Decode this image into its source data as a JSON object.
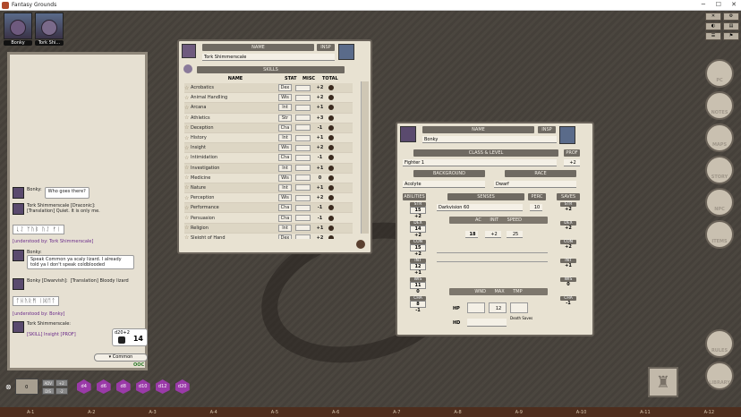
{
  "window": {
    "title": "Fantasy Grounds"
  },
  "party": [
    {
      "name": "Bonky"
    },
    {
      "name": "Tork Shi..."
    }
  ],
  "chat": {
    "messages": [
      {
        "speaker": "Bonky:",
        "text": "Who goes there?"
      },
      {
        "speaker": "Tork Shimmerscale [Draconic]:",
        "text": "[Translation] Quiet. It is only me."
      },
      {
        "runes": "ᚳᛇ ᛉᚢᛒ ᚢᛇ ᚠᛁ"
      },
      {
        "system": "[understood by: Tork Shimmerscale]"
      },
      {
        "speaker": "Bonky:",
        "text": "Speak Common ya scaly lizard. I already told ya I don't speak coldblooded"
      },
      {
        "speaker": "Bonky [Dwarvish]:",
        "text": "[Translation] Bloody lizard"
      },
      {
        "runes": "ᛏᚺᚢᚱᛗ ᛁᛞᛖᛏ"
      },
      {
        "system": "[understood by: Bonky]"
      },
      {
        "speaker": "Tork Shimmerscale:",
        "text": "[SKILL] Insight [PROF]"
      }
    ],
    "dice_expr": "d20+2",
    "dice_total": "14",
    "language": "Common",
    "occ": "OOC"
  },
  "sheet1": {
    "name_label": "NAME",
    "insp_label": "INSP",
    "name": "Tork Shimmerscale",
    "skills_label": "SKILLS",
    "columns": [
      "NAME",
      "STAT",
      "MISC",
      "TOTAL"
    ],
    "skills": [
      {
        "name": "Acrobatics",
        "stat": "Dex",
        "total": "+2"
      },
      {
        "name": "Animal Handling",
        "stat": "Wis",
        "total": "+2"
      },
      {
        "name": "Arcana",
        "stat": "Int",
        "total": "+1"
      },
      {
        "name": "Athletics",
        "stat": "Str",
        "total": "+3"
      },
      {
        "name": "Deception",
        "stat": "Cha",
        "total": "-1"
      },
      {
        "name": "History",
        "stat": "Int",
        "total": "+1"
      },
      {
        "name": "Insight",
        "stat": "Wis",
        "total": "+2"
      },
      {
        "name": "Intimidation",
        "stat": "Cha",
        "total": "-1"
      },
      {
        "name": "Investigation",
        "stat": "Int",
        "total": "+1"
      },
      {
        "name": "Medicine",
        "stat": "Wis",
        "total": "0"
      },
      {
        "name": "Nature",
        "stat": "Int",
        "total": "+1"
      },
      {
        "name": "Perception",
        "stat": "Wis",
        "total": "+2"
      },
      {
        "name": "Performance",
        "stat": "Cha",
        "total": "-1"
      },
      {
        "name": "Persuasion",
        "stat": "Cha",
        "total": "-1"
      },
      {
        "name": "Religion",
        "stat": "Int",
        "total": "+1"
      },
      {
        "name": "Sleight of Hand",
        "stat": "Dex",
        "total": "+2"
      }
    ]
  },
  "sheet2": {
    "name_label": "NAME",
    "insp_label": "INSP",
    "name": "Bonky",
    "class_label": "CLASS & LEVEL",
    "prof_label": "PROF",
    "class": "Fighter 1",
    "prof": "+2",
    "background_label": "BACKGROUND",
    "race_label": "RACE",
    "background": "Acolyte",
    "race": "Dwarf",
    "abilities_label": "ABILITIES",
    "senses_label": "SENSES",
    "perc_label": "PERC",
    "saves_label": "SAVES",
    "senses": "Darkvision 60",
    "perc": "10",
    "ac_label": "AC",
    "init_label": "INIT",
    "speed_label": "SPEED",
    "ac": "18",
    "init": "+2",
    "speed": "25",
    "wounds_label": "WND",
    "max_label": "MAX",
    "temp_label": "TMP",
    "hp_label": "HP",
    "hd_label": "HD",
    "max_hp": "12",
    "death_saves_label": "Death Saves",
    "abilities": [
      {
        "label": "STR",
        "score": "15",
        "mod": "+2"
      },
      {
        "label": "DEX",
        "score": "14",
        "mod": "+2"
      },
      {
        "label": "CON",
        "score": "15",
        "mod": "+2"
      },
      {
        "label": "INT",
        "score": "12",
        "mod": "+1"
      },
      {
        "label": "WIS",
        "score": "11",
        "mod": "0"
      },
      {
        "label": "CHA",
        "score": "8",
        "mod": "-1"
      }
    ],
    "saves": [
      {
        "label": "STR",
        "mod": "+2"
      },
      {
        "label": "DEX",
        "mod": "+2"
      },
      {
        "label": "CON",
        "mod": "+2"
      },
      {
        "label": "INT",
        "mod": "+1"
      },
      {
        "label": "WIS",
        "mod": "0"
      },
      {
        "label": "CHA",
        "mod": "-1"
      }
    ]
  },
  "sidebar": [
    "PC",
    "NOTES",
    "MAPS",
    "STORY",
    "NPC",
    "ITEMS"
  ],
  "sidebar_bottom": [
    "RULES",
    "LIBRARY"
  ],
  "dice": [
    "d4",
    "d6",
    "d8",
    "d10",
    "d12",
    "d20"
  ],
  "tray": {
    "mod": "0",
    "buttons": [
      "ADV",
      "+2",
      "DIS",
      "-2"
    ]
  },
  "grid": [
    "A-1",
    "A-2",
    "A-3",
    "A-4",
    "A-5",
    "A-6",
    "A-7",
    "A-8",
    "A-9",
    "A-10",
    "A-11",
    "A-12"
  ]
}
